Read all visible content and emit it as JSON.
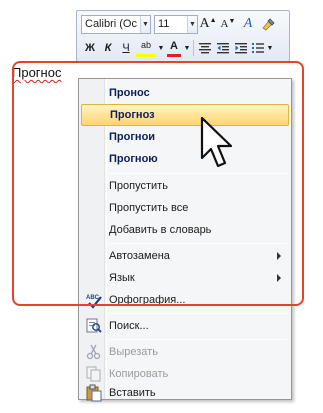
{
  "mini_toolbar": {
    "font_name": "Calibri (Ос",
    "font_size": "11",
    "grow_font_icon": "A",
    "shrink_font_icon": "A",
    "styles_icon": "A",
    "bold_label": "Ж",
    "italic_label": "К",
    "underline_label": "Ч",
    "highlight_label": "ab",
    "font_color_label": "A",
    "colors": {
      "font_color": "#e02020",
      "highlight": "#ffff00"
    }
  },
  "document": {
    "word": "Прогнос"
  },
  "context_menu": {
    "suggestions": [
      "Пронос",
      "Прогноз",
      "Прогнои",
      "Прогною"
    ],
    "highlighted_index": 1,
    "spell_actions": [
      "Пропустить",
      "Пропустить все",
      "Добавить в словарь"
    ],
    "submenus": [
      "Автозамена",
      "Язык"
    ],
    "spelling": "Орфография...",
    "search": "Поиск...",
    "cut": "Вырезать",
    "copy": "Копировать",
    "paste": "Вставить"
  },
  "colors": {
    "highlight_box": "#e8412c",
    "menu_highlight": "#ffd66e"
  }
}
